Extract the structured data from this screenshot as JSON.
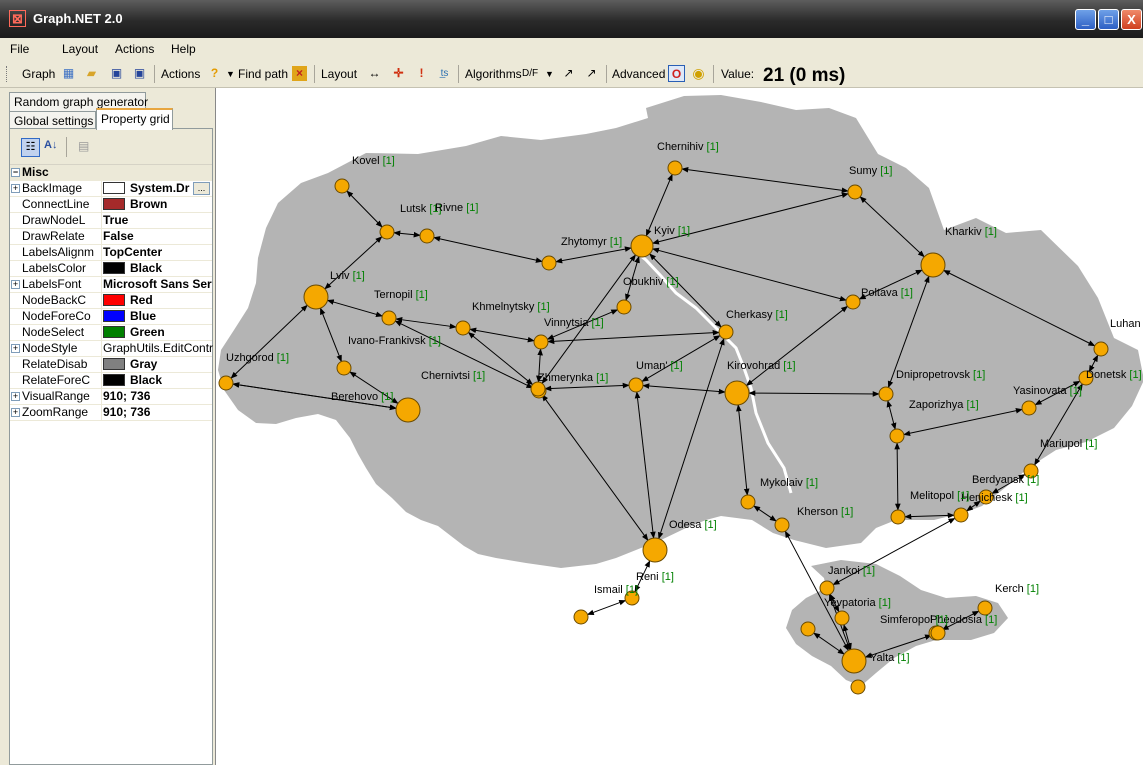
{
  "window": {
    "title": "Graph.NET 2.0",
    "btn_min": "_",
    "btn_max": "□",
    "btn_close": "X"
  },
  "menu": [
    "File",
    "Layout",
    "Actions",
    "Help"
  ],
  "toolbar": {
    "graph_label": "Graph",
    "actions_label": "Actions",
    "find_path_label": "Find path",
    "layout_label": "Layout",
    "algorithms_label": "Algorithms",
    "df_label": "D/F",
    "advanced_label": "Advanced",
    "value_label": "Value:",
    "value": "21 (0 ms)"
  },
  "tabs": {
    "random": "Random graph generator",
    "global": "Global settings",
    "property_grid": "Property grid"
  },
  "property_grid": {
    "category": "Misc",
    "rows": [
      {
        "name": "BackImage",
        "value": "System.Dr",
        "expandable": true,
        "swatch": "#ffffff"
      },
      {
        "name": "ConnectLine",
        "value": "Brown",
        "swatch": "#a52a2a"
      },
      {
        "name": "DrawNodeL",
        "value": "True"
      },
      {
        "name": "DrawRelate",
        "value": "False"
      },
      {
        "name": "LabelsAlignm",
        "value": "TopCenter"
      },
      {
        "name": "LabelsColor",
        "value": "Black",
        "swatch": "#000000"
      },
      {
        "name": "LabelsFont",
        "value": "Microsoft Sans Ser",
        "expandable": true
      },
      {
        "name": "NodeBackC",
        "value": "Red",
        "swatch": "#ff0000"
      },
      {
        "name": "NodeForeCo",
        "value": "Blue",
        "swatch": "#0000ff"
      },
      {
        "name": "NodeSelect",
        "value": "Green",
        "swatch": "#008000"
      },
      {
        "name": "NodeStyle",
        "value": "GraphUtils.EditControl.",
        "expandable": true,
        "normal": true
      },
      {
        "name": "RelateDisab",
        "value": "Gray",
        "swatch": "#808080"
      },
      {
        "name": "RelateForeC",
        "value": "Black",
        "swatch": "#000000"
      },
      {
        "name": "VisualRange",
        "value": "910; 736",
        "expandable": true
      },
      {
        "name": "ZoomRange",
        "value": "910; 736",
        "expandable": true
      }
    ]
  },
  "graph": {
    "node_color": "#f5a800",
    "edge_color": "#000000",
    "label_count_color": "#008000",
    "map_color": "#b4b4b4",
    "nodes": [
      {
        "id": "Chernihiv",
        "label": "Chernihiv",
        "count": "[1]"
      },
      {
        "id": "Sumy",
        "label": "Sumy",
        "count": "[1]"
      },
      {
        "id": "Kovel",
        "label": "Kovel",
        "count": "[1]"
      },
      {
        "id": "Lutsk",
        "label": "Lutsk",
        "count": "[1]"
      },
      {
        "id": "Rivne",
        "label": "Rivne",
        "count": "[1]"
      },
      {
        "id": "Kyiv",
        "label": "Kyiv",
        "count": "[1]"
      },
      {
        "id": "Zhytomyr",
        "label": "Zhytomyr",
        "count": "[1]"
      },
      {
        "id": "Kharkiv",
        "label": "Kharkiv",
        "count": "[1]"
      },
      {
        "id": "Lviv",
        "label": "Lviv",
        "count": "[1]"
      },
      {
        "id": "Ternopil",
        "label": "Ternopil",
        "count": "[1]"
      },
      {
        "id": "Khmelnytsky",
        "label": "Khmelnytsky",
        "count": "[1]"
      },
      {
        "id": "Obukhiv",
        "label": "Obukhiv",
        "count": "[1]"
      },
      {
        "id": "Poltava",
        "label": "Poltava",
        "count": "[1]"
      },
      {
        "id": "Vinnytsia",
        "label": "Vinnytsia",
        "count": "[1]"
      },
      {
        "id": "Cherkasy",
        "label": "Cherkasy",
        "count": "[1]"
      },
      {
        "id": "Luhansk",
        "label": "Luhan",
        "count": ""
      },
      {
        "id": "IvanoFrankivsk",
        "label": "Ivano-Frankivsk",
        "count": "[1]"
      },
      {
        "id": "Uzhgorod",
        "label": "Uzhgorod",
        "count": "[1]"
      },
      {
        "id": "Chernivtsi",
        "label": "Chernivtsi",
        "count": "[1]"
      },
      {
        "id": "Zhmerynka",
        "label": "Zhmerynka",
        "count": "[1]"
      },
      {
        "id": "Uman",
        "label": "Uman'",
        "count": "[1]"
      },
      {
        "id": "Kirovohrad",
        "label": "Kirovohrad",
        "count": "[1]"
      },
      {
        "id": "Dnipropetrovsk",
        "label": "Dnipropetrovsk",
        "count": "[1]"
      },
      {
        "id": "Donetsk",
        "label": "Donetsk",
        "count": "[1]"
      },
      {
        "id": "Berehovo",
        "label": "Berehovo",
        "count": "[1]"
      },
      {
        "id": "Zaporizhya",
        "label": "Zaporizhya",
        "count": "[1]"
      },
      {
        "id": "Yasinovata",
        "label": "Yasinovata",
        "count": "[1]"
      },
      {
        "id": "Mariupol",
        "label": "Mariupol",
        "count": "[1]"
      },
      {
        "id": "Berdyansk",
        "label": "Berdyansk",
        "count": "[1]"
      },
      {
        "id": "Henichesk",
        "label": "Henichesk",
        "count": "[1]"
      },
      {
        "id": "Mykolaiv",
        "label": "Mykolaiv",
        "count": "[1]"
      },
      {
        "id": "Kherson",
        "label": "Kherson",
        "count": "[1]"
      },
      {
        "id": "Melitopol",
        "label": "Melitopol",
        "count": "[1]"
      },
      {
        "id": "Odesa",
        "label": "Odesa",
        "count": "[1]"
      },
      {
        "id": "Reni",
        "label": "Reni",
        "count": "[1]"
      },
      {
        "id": "Ismail",
        "label": "Ismail",
        "count": "[1]"
      },
      {
        "id": "Jankoi",
        "label": "Jankoi",
        "count": "[1]"
      },
      {
        "id": "Kerch",
        "label": "Kerch",
        "count": "[1]"
      },
      {
        "id": "Yevpatoria",
        "label": "Yevpatoria",
        "count": "[1]"
      },
      {
        "id": "Feodosia",
        "label": "Pheodosia",
        "count": "[1]"
      },
      {
        "id": "Simferopol",
        "label": "Simferopol",
        "count": "[1]"
      },
      {
        "id": "Sevastopol",
        "label": "",
        "count": ""
      },
      {
        "id": "Yalta",
        "label": "Yalta",
        "count": "[1]"
      },
      {
        "id": "YaltaSouth",
        "label": "",
        "count": ""
      }
    ],
    "edges": [
      [
        "Kovel",
        "Lutsk"
      ],
      [
        "Lutsk",
        "Rivne"
      ],
      [
        "Lutsk",
        "Lviv"
      ],
      [
        "Rivne",
        "Zhytomyr"
      ],
      [
        "Zhytomyr",
        "Kyiv"
      ],
      [
        "Kyiv",
        "Chernihiv"
      ],
      [
        "Chernihiv",
        "Sumy"
      ],
      [
        "Kyiv",
        "Sumy"
      ],
      [
        "Sumy",
        "Kharkiv"
      ],
      [
        "Kyiv",
        "Poltava"
      ],
      [
        "Kyiv",
        "Obukhiv"
      ],
      [
        "Kyiv",
        "Cherkasy"
      ],
      [
        "Kyiv",
        "Zhmerynka"
      ],
      [
        "Kharkiv",
        "Poltava"
      ],
      [
        "Kharkiv",
        "Luhansk"
      ],
      [
        "Kharkiv",
        "Dnipropetrovsk"
      ],
      [
        "Lviv",
        "Ternopil"
      ],
      [
        "Lviv",
        "IvanoFrankivsk"
      ],
      [
        "Lviv",
        "Uzhgorod"
      ],
      [
        "Ternopil",
        "Khmelnytsky"
      ],
      [
        "Ternopil",
        "Chernivtsi"
      ],
      [
        "Khmelnytsky",
        "Vinnytsia"
      ],
      [
        "Khmelnytsky",
        "Zhmerynka"
      ],
      [
        "Obukhiv",
        "Vinnytsia"
      ],
      [
        "Vinnytsia",
        "Zhmerynka"
      ],
      [
        "Vinnytsia",
        "Cherkasy"
      ],
      [
        "Zhmerynka",
        "Uman"
      ],
      [
        "Zhmerynka",
        "Odesa"
      ],
      [
        "Uman",
        "Cherkasy"
      ],
      [
        "Uman",
        "Odesa"
      ],
      [
        "Uman",
        "Kirovohrad"
      ],
      [
        "Cherkasy",
        "Odesa"
      ],
      [
        "Poltava",
        "Kirovohrad"
      ],
      [
        "Kirovohrad",
        "Dnipropetrovsk"
      ],
      [
        "Kirovohrad",
        "Mykolaiv"
      ],
      [
        "Dnipropetrovsk",
        "Zaporizhya"
      ],
      [
        "Zaporizhya",
        "Yasinovata"
      ],
      [
        "Zaporizhya",
        "Melitopol"
      ],
      [
        "Donetsk",
        "Yasinovata"
      ],
      [
        "Donetsk",
        "Luhansk"
      ],
      [
        "Donetsk",
        "Mariupol"
      ],
      [
        "Mariupol",
        "Berdyansk"
      ],
      [
        "Berdyansk",
        "Henichesk"
      ],
      [
        "Melitopol",
        "Henichesk"
      ],
      [
        "Henichesk",
        "Jankoi"
      ],
      [
        "Mykolaiv",
        "Kherson"
      ],
      [
        "Kherson",
        "Yalta"
      ],
      [
        "Odesa",
        "Reni"
      ],
      [
        "Reni",
        "Ismail"
      ],
      [
        "Uzhgorod",
        "Berehovo"
      ],
      [
        "IvanoFrankivsk",
        "Berehovo"
      ],
      [
        "Chernivtsi",
        "Zhmerynka"
      ],
      [
        "Berehovo",
        "Uzhgorod"
      ],
      [
        "Jankoi",
        "Yalta"
      ],
      [
        "Jankoi",
        "Yevpatoria"
      ],
      [
        "Simferopol",
        "Feodosia"
      ],
      [
        "Simferopol",
        "Yalta"
      ],
      [
        "Feodosia",
        "Kerch"
      ],
      [
        "Sevastopol",
        "Yalta"
      ],
      [
        "Yevpatoria",
        "Yalta"
      ]
    ]
  }
}
